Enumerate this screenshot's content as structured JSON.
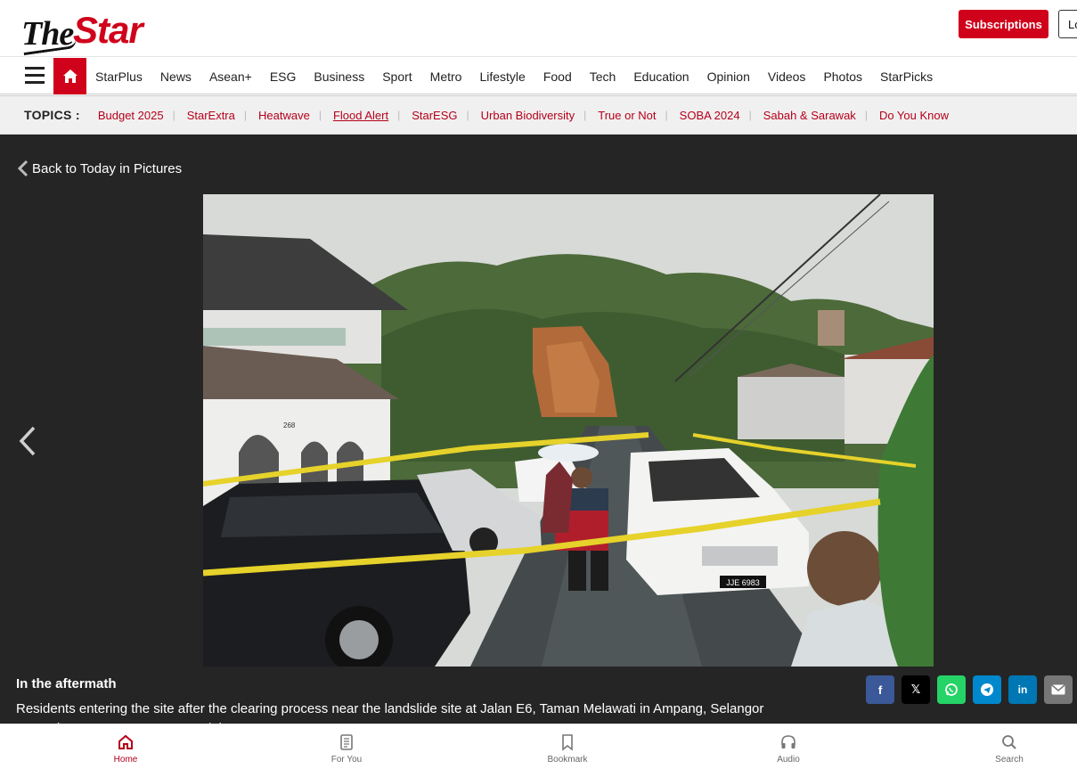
{
  "header": {
    "logo_the": "The",
    "logo_star": "Star",
    "subscriptions_label": "Subscriptions",
    "login_label": "Lo"
  },
  "nav": {
    "items": [
      "StarPlus",
      "News",
      "Asean+",
      "ESG",
      "Business",
      "Sport",
      "Metro",
      "Lifestyle",
      "Food",
      "Tech",
      "Education",
      "Opinion",
      "Videos",
      "Photos",
      "StarPicks"
    ]
  },
  "topics": {
    "label": "TOPICS :",
    "items": [
      "Budget 2025",
      "StarExtra",
      "Heatwave",
      "Flood Alert",
      "StarESG",
      "Urban Biodiversity",
      "True or Not",
      "SOBA 2024",
      "Sabah & Sarawak",
      "Do You Know"
    ],
    "active": "Flood Alert"
  },
  "gallery": {
    "back_label": "Back to Today in Pictures",
    "photo_plate": "JJE 6983",
    "photo_house_number": "268",
    "caption_title": "In the aftermath",
    "caption_text": "Residents entering the site after the clearing process near the landslide site at Jalan E6, Taman Melawati in Ampang, Selangor",
    "caption_credit": "yesterday. — CHAN TAK KONG/The Star"
  },
  "share": {
    "facebook": "f",
    "x": "𝕏",
    "whatsapp": "whatsapp-icon",
    "telegram": "telegram-icon",
    "linkedin": "in",
    "email": "email-icon",
    "colors": {
      "facebook": "#3b5998",
      "x": "#000000",
      "whatsapp": "#25d366",
      "telegram": "#0088cc",
      "linkedin": "#0077b5",
      "email": "#777777"
    }
  },
  "bottom_nav": {
    "items": [
      "Home",
      "For You",
      "Bookmark",
      "Audio",
      "Search"
    ],
    "active": "Home"
  },
  "colors": {
    "brand_red": "#d0021b",
    "gallery_bg": "#252525"
  }
}
